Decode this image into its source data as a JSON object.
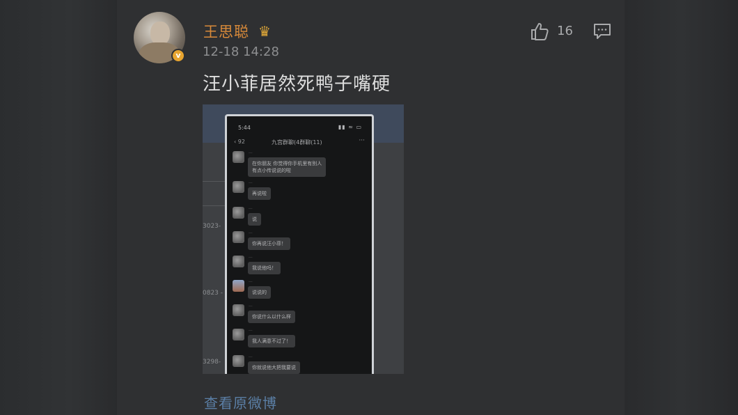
{
  "post": {
    "username": "王思聪",
    "timestamp": "12-18 14:28",
    "text": "汪小菲居然死鸭子嘴硬",
    "likes": "16",
    "view_original": "查看原微博",
    "verified_badge": "v",
    "icons": {
      "crown": "crown-icon",
      "like": "thumbs-up-icon",
      "comment": "comment-icon"
    },
    "colors": {
      "username": "#d98a3a",
      "link": "#5b7fa6",
      "background": "#2f3032"
    }
  },
  "embedded_screenshot": {
    "status_time": "5:44",
    "status_icons": "▮▮ ≈ ▭",
    "chat_back": "‹ 92",
    "chat_title": "九宫群聊(4群聊(11)",
    "chat_more": "···",
    "edge_labels": [
      "3023-",
      "0823 -",
      "3298-"
    ],
    "messages": [
      {
        "name": "···",
        "lines": [
          "在你朋友 你觉得你手机里有别人",
          "有点小传说说的啦"
        ]
      },
      {
        "name": "···",
        "lines": [
          "再说啦"
        ]
      },
      {
        "name": "···",
        "lines": [
          "说"
        ]
      },
      {
        "name": "···",
        "lines": [
          "你再说汪小菲！"
        ]
      },
      {
        "name": "···",
        "lines": [
          "我说他吗！"
        ]
      },
      {
        "name": "···",
        "lines": [
          "说说的"
        ]
      },
      {
        "name": "···",
        "lines": [
          "你说什么以什么样"
        ]
      },
      {
        "name": "···",
        "lines": [
          "我人满意不过了！"
        ]
      },
      {
        "name": "···",
        "lines": [
          "你就说他大把我要说"
        ]
      }
    ]
  }
}
